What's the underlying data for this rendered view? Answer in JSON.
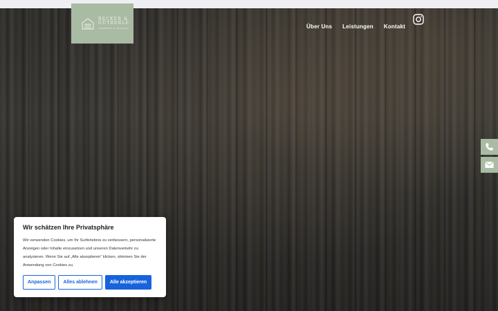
{
  "logo": {
    "line1": "BECKER &",
    "line2": "GÜTBERLE",
    "line3": "ZIMMEREI & HOLZBAU"
  },
  "nav": {
    "items": [
      {
        "label": "Über Uns"
      },
      {
        "label": "Leistungen"
      },
      {
        "label": "Kontakt"
      }
    ]
  },
  "icons": {
    "social": "instagram-icon",
    "contact": [
      "phone-icon",
      "envelope-icon"
    ]
  },
  "colors": {
    "brand_green": "#a9bba3",
    "cookie_accent": "#1863dc"
  },
  "cookie": {
    "title": "Wir schätzen Ihre Privatsphäre",
    "body": "Wir verwenden Cookies, um Ihr Surferlebnis zu verbessern, personalisierte Anzeigen oder Inhalte einzusetzen und unseren Datenverkehr zu analysieren. Wenn Sie auf „Alle akzeptieren“ klicken, stimmen Sie der Anwendung von Cookies zu.",
    "customize_label": "Anpassen",
    "reject_label": "Alles ablehnen",
    "accept_label": "Alle akzeptieren"
  }
}
